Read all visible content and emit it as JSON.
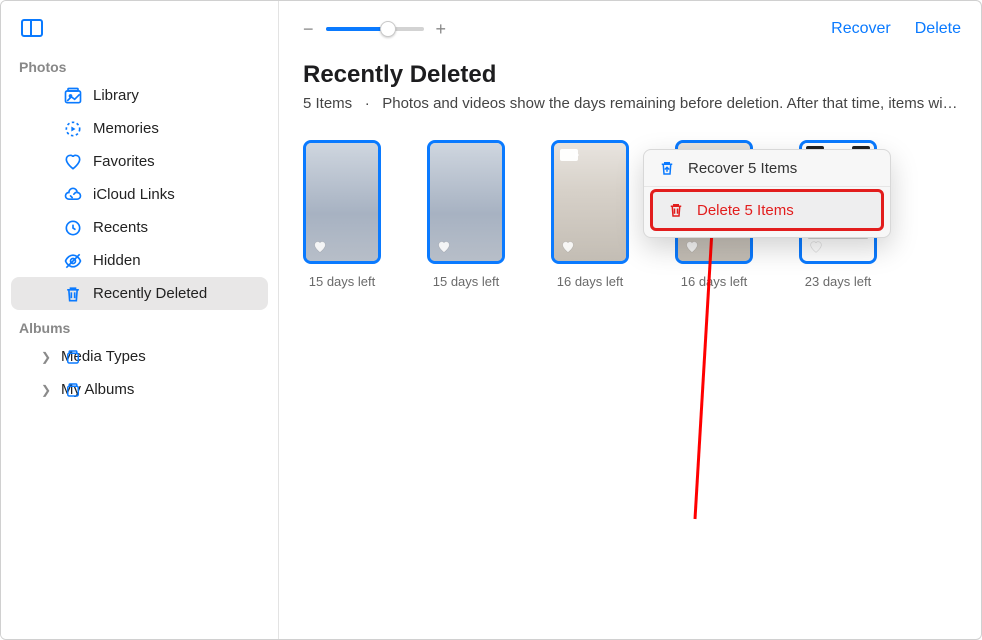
{
  "sidebar": {
    "sections": {
      "photos_label": "Photos",
      "albums_label": "Albums"
    },
    "items": [
      {
        "label": "Library",
        "icon": "library-icon"
      },
      {
        "label": "Memories",
        "icon": "memories-icon"
      },
      {
        "label": "Favorites",
        "icon": "heart-icon"
      },
      {
        "label": "iCloud Links",
        "icon": "cloud-link-icon"
      },
      {
        "label": "Recents",
        "icon": "clock-icon"
      },
      {
        "label": "Hidden",
        "icon": "eye-slash-icon"
      },
      {
        "label": "Recently Deleted",
        "icon": "trash-icon"
      }
    ],
    "album_items": [
      {
        "label": "Media Types",
        "icon": "box-icon"
      },
      {
        "label": "My Albums",
        "icon": "box-icon"
      }
    ]
  },
  "topbar": {
    "zoom_minus": "−",
    "zoom_plus": "+",
    "recover": "Recover",
    "delete": "Delete"
  },
  "header": {
    "title": "Recently Deleted",
    "subtitle_count": "5 Items",
    "subtitle_sep": "·",
    "subtitle_text": "Photos and videos show the days remaining before deletion. After that time, items wi…"
  },
  "thumbnails": [
    {
      "caption": "15 days left",
      "kind": "photo"
    },
    {
      "caption": "15 days left",
      "kind": "photo"
    },
    {
      "caption": "16 days left",
      "kind": "video"
    },
    {
      "caption": "16 days left",
      "kind": "video"
    },
    {
      "caption": "23 days left",
      "kind": "screenshot"
    }
  ],
  "context_menu": {
    "recover": "Recover 5 Items",
    "delete": "Delete 5 Items"
  }
}
